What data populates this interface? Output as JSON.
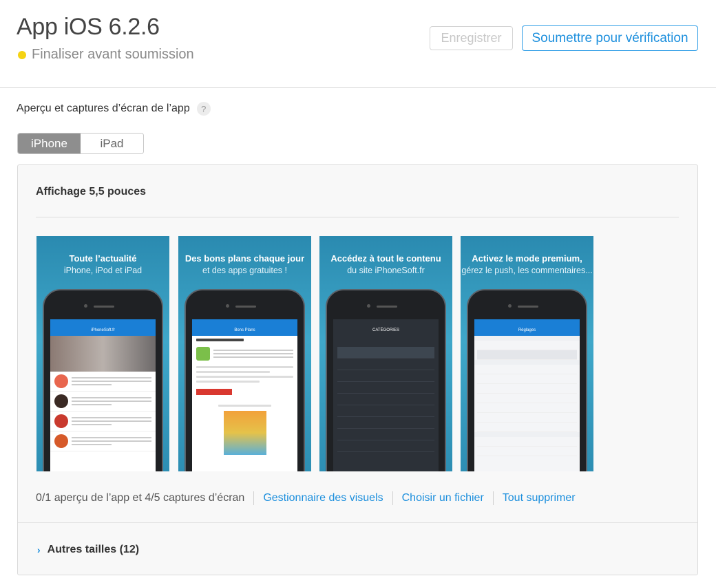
{
  "header": {
    "title": "App iOS 6.2.6",
    "status": "Finaliser avant soumission",
    "status_color": "#f5d314",
    "save_label": "Enregistrer",
    "submit_label": "Soumettre pour vérification"
  },
  "section": {
    "title": "Aperçu et captures d’écran de l’app",
    "help": "?"
  },
  "device_tabs": [
    {
      "label": "iPhone",
      "active": true
    },
    {
      "label": "iPad",
      "active": false
    }
  ],
  "panel": {
    "display_title": "Affichage 5,5 pouces",
    "screenshots": [
      {
        "title": "Toute l’actualité",
        "subtitle": "iPhone, iPod et iPad",
        "nav": "iPhoneSoft.fr"
      },
      {
        "title": "Des bons plans chaque jour",
        "subtitle": "et des apps gratuites !",
        "nav": "Bons Plans"
      },
      {
        "title": "Accédez à tout le contenu",
        "subtitle": "du site iPhoneSoft.fr",
        "nav": "CATÉGORIES"
      },
      {
        "title": "Activez le mode premium,",
        "subtitle": "gérez le push, les commentaires...",
        "nav": "Réglages"
      }
    ],
    "count_text": "0/1 aperçu de l’app et 4/5 captures d’écran",
    "links": {
      "media_manager": "Gestionnaire des visuels",
      "choose_file": "Choisir un fichier",
      "delete_all": "Tout supprimer"
    },
    "other_sizes": "Autres tailles (12)"
  },
  "colors": {
    "accent": "#1c8fdd",
    "screenshot_bg": "#3fa7c9"
  }
}
